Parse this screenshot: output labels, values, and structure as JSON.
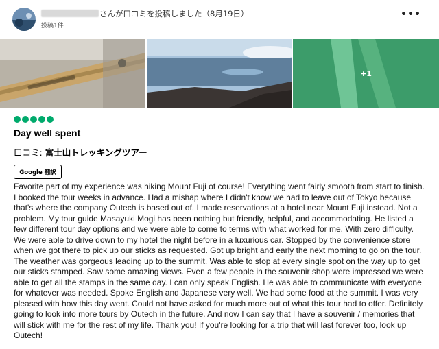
{
  "header": {
    "author_suffix": "さんが口コミを投稿しました（8月19日）",
    "post_count": "投稿1件",
    "more_icon": "more-options-icon"
  },
  "photos": {
    "extra_count": "+1",
    "items": [
      "souvenir-walking-stick-photo",
      "mountain-view-photo",
      "stick-closeup-photo"
    ]
  },
  "review": {
    "rating": 5,
    "rating_color": "#00aa6c",
    "title": "Day well spent",
    "reviewed_prefix": "口コミ: ",
    "tour_name": "富士山トレッキングツアー",
    "translate_label": "Google 翻訳",
    "body": "Favorite part of my experience was hiking Mount Fuji of course! Everything went fairly smooth from start to finish. I booked the tour weeks in advance. Had a mishap where I didn't know we had to leave out of Tokyo because that's where the company Outech is based out of. I made reservations at a hotel near Mount Fuji instead. Not a problem. My tour guide Masayuki Mogi has been nothing but friendly, helpful, and accommodating. He listed a few different tour day options and we were able to come to terms with what worked for me. With zero difficulty. We were able to drive down to my hotel the night before in a luxurious car. Stopped by the convenience store when we got there to pick up our sticks as requested. Got up bright and early the next morning to go on the tour. The weather was gorgeous leading up to the summit. Was able to stop at every single spot on the way up to get our sticks stamped. Saw some amazing views. Even a few people in the souvenir shop were impressed we were able to get all the stamps in the same day. I can only speak English. He was able to communicate with everyone for whatever was needed. Spoke English and Japanese very well. We had some food at the summit. I was very pleased with how this day went. Could not have asked for much more out of what this tour had to offer. Definitely going to look into more tours by Outech in the future. And now I can say that I have a souvenir / memories that will stick with me for the rest of my life. Thank you! If you're looking for a trip that will last forever too, look up Outech!"
  }
}
